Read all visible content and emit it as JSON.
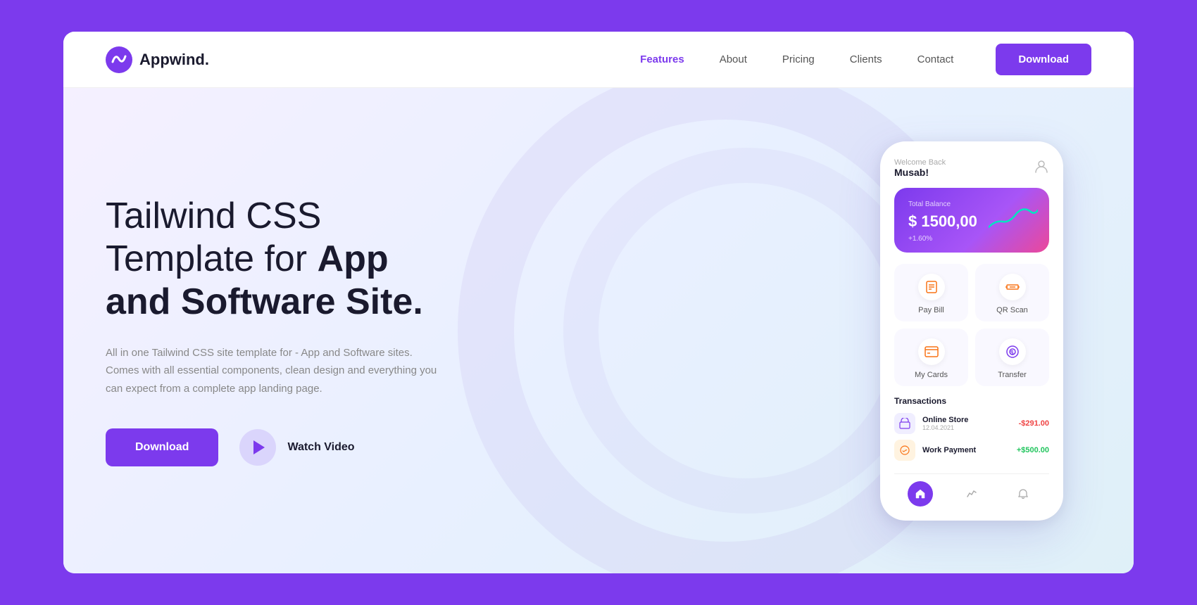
{
  "page": {
    "bg_color": "#7c3aed"
  },
  "navbar": {
    "logo_text": "Appwind.",
    "links": [
      {
        "label": "Features",
        "active": true
      },
      {
        "label": "About",
        "active": false
      },
      {
        "label": "Pricing",
        "active": false
      },
      {
        "label": "Clients",
        "active": false
      },
      {
        "label": "Contact",
        "active": false
      }
    ],
    "download_btn": "Download"
  },
  "hero": {
    "title_line1": "Tailwind CSS",
    "title_line2_normal": "Template for ",
    "title_line2_bold": "App",
    "title_line3": "and Software Site.",
    "description": "All in one Tailwind CSS site template for - App and Software sites. Comes with all essential components, clean design and everything you can expect from a complete app landing page.",
    "btn_download": "Download",
    "btn_watch": "Watch Video"
  },
  "phone": {
    "welcome": "Welcome Back",
    "user": "Musab!",
    "balance_label": "Total Balance",
    "balance_amount": "$ 1500,00",
    "balance_change": "+1.60%",
    "actions": [
      {
        "label": "Pay Bill"
      },
      {
        "label": "QR Scan"
      },
      {
        "label": "My Cards"
      },
      {
        "label": "Transfer"
      }
    ],
    "transactions_title": "Transactions",
    "transactions": [
      {
        "name": "Online Store",
        "date": "12.04.2021",
        "amount": "-$291.00",
        "type": "neg"
      },
      {
        "name": "Work Payment",
        "date": "",
        "amount": "+$500.00",
        "type": "pos"
      }
    ]
  }
}
